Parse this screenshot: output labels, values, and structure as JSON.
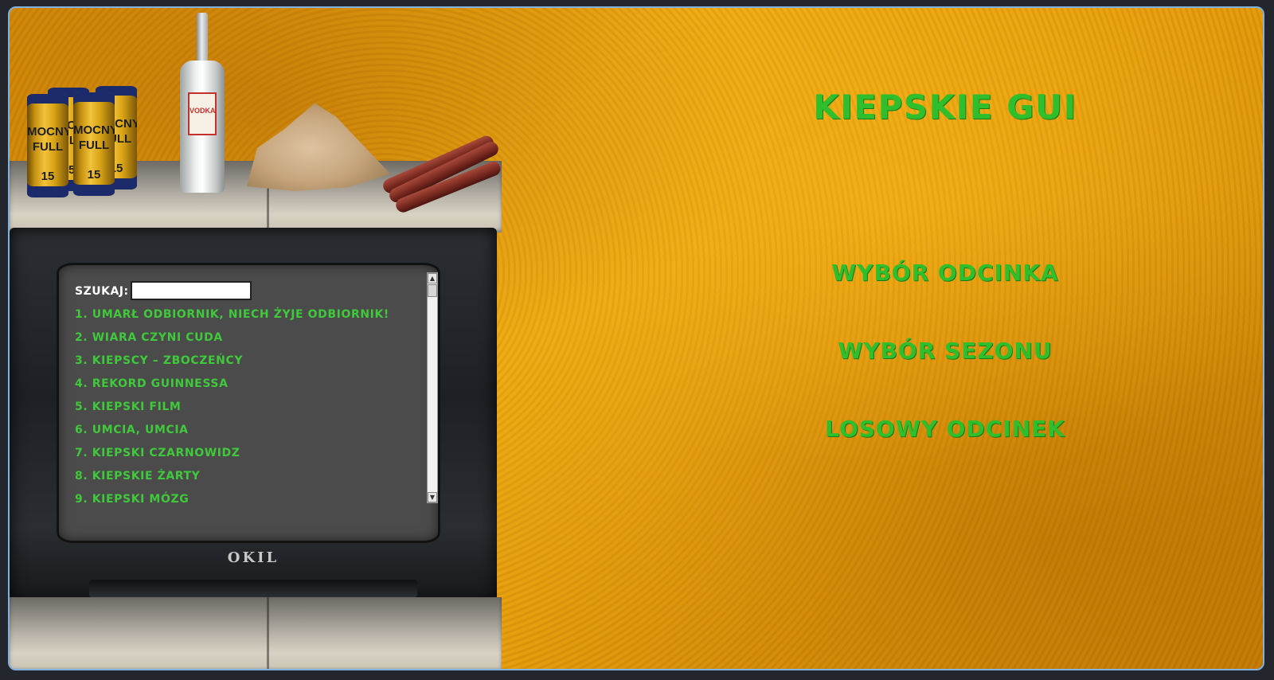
{
  "app": {
    "title": "KIEPSKIE GUI"
  },
  "search": {
    "label": "SZUKAJ:",
    "value": "",
    "placeholder": ""
  },
  "episodes": [
    {
      "label": "1. UMARŁ ODBIORNIK, NIECH ŻYJE ODBIORNIK!"
    },
    {
      "label": "2. WIARA CZYNI CUDA"
    },
    {
      "label": "3. KIEPSCY – ZBOCZEŃCY"
    },
    {
      "label": "4. REKORD GUINNESSA"
    },
    {
      "label": "5. KIEPSKI FILM"
    },
    {
      "label": "6. UMCIA, UMCIA"
    },
    {
      "label": "7. KIEPSKI CZARNOWIDZ"
    },
    {
      "label": "8. KIEPSKIE ŻARTY"
    },
    {
      "label": "9. KIEPSKI MÓZG"
    }
  ],
  "menu": {
    "episode_select": "WYBÓR ODCINKA",
    "season_select": "WYBÓR SEZONU",
    "random_episode": "LOSOWY ODCINEK"
  },
  "decor": {
    "tv_brand": "OKIL",
    "can_text": "MOCNY FULL",
    "can_number": "15",
    "bottle_text": "VODKA"
  },
  "colors": {
    "accent_green": "#2fbf2c",
    "list_green": "#3fc93b",
    "background_orange": "#e79e0b"
  }
}
